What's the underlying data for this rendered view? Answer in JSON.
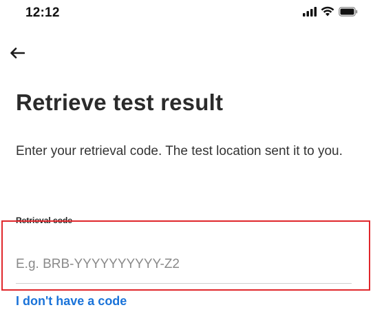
{
  "status_bar": {
    "time": "12:12",
    "icons": [
      "signal-icon",
      "wifi-icon",
      "battery-icon"
    ]
  },
  "header": {
    "back_icon": "arrow-left-icon"
  },
  "main": {
    "title": "Retrieve test result",
    "instructions": "Enter your retrieval code. The test location sent it to you.",
    "field_label": "Retrieval code",
    "input_value": "",
    "input_placeholder": "E.g. BRB-YYYYYYYYYY-Z2",
    "no_code_link": "I don't have a code"
  },
  "colors": {
    "link": "#1a73d9",
    "highlight": "#e0262b",
    "title": "#2b2b2b"
  }
}
